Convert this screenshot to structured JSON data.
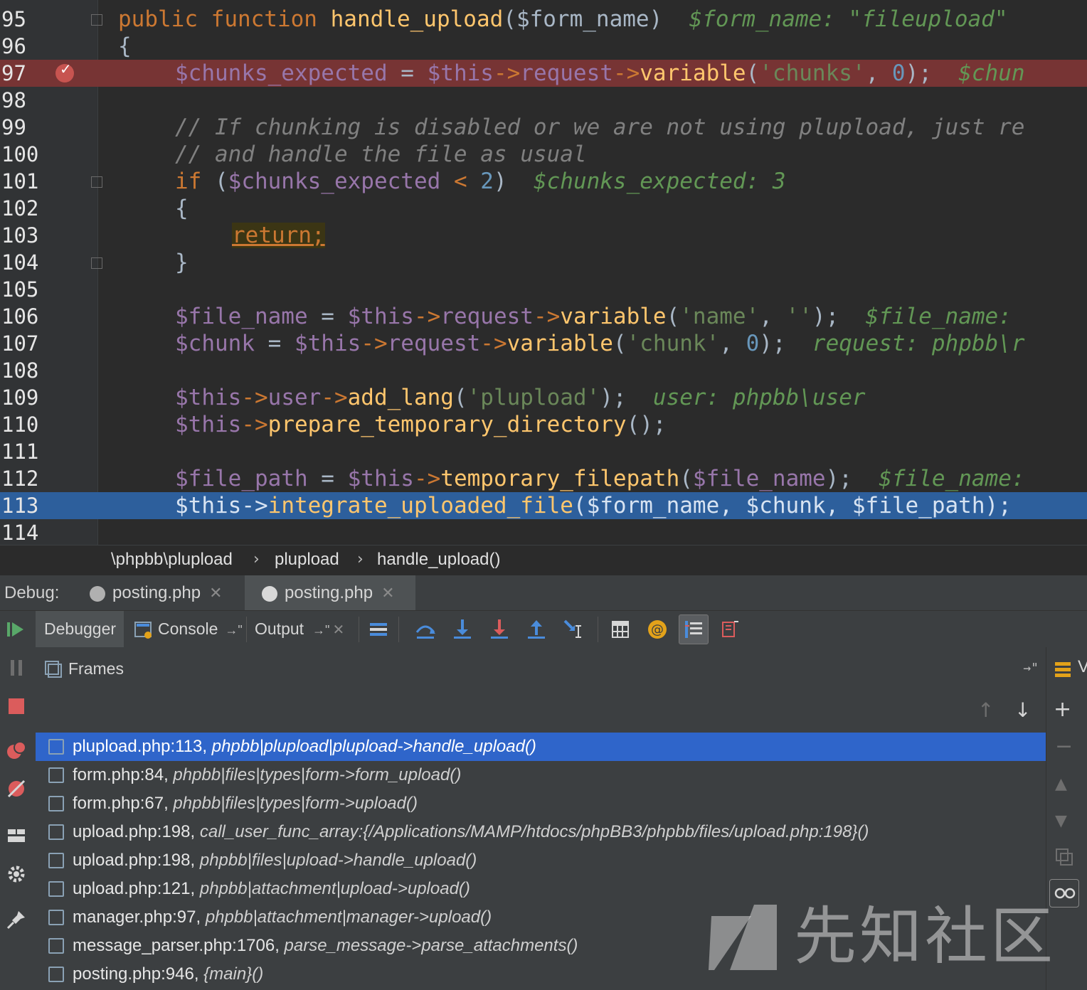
{
  "editor": {
    "lines": [
      {
        "num": "95"
      },
      {
        "num": "96"
      },
      {
        "num": "97"
      },
      {
        "num": "98"
      },
      {
        "num": "99"
      },
      {
        "num": "100"
      },
      {
        "num": "101"
      },
      {
        "num": "102"
      },
      {
        "num": "103"
      },
      {
        "num": "104"
      },
      {
        "num": "105"
      },
      {
        "num": "106"
      },
      {
        "num": "107"
      },
      {
        "num": "108"
      },
      {
        "num": "109"
      },
      {
        "num": "110"
      },
      {
        "num": "111"
      },
      {
        "num": "112"
      },
      {
        "num": "113"
      },
      {
        "num": "114"
      }
    ],
    "code": {
      "l95": {
        "kw1": "public",
        "kw2": "function",
        "fn": "handle_upload",
        "params": "($form_name)",
        "hint": "$form_name: \"fileupload\""
      },
      "l96": "{",
      "l97": {
        "var1": "$chunks_expected",
        "eq": " = ",
        "this": "$this",
        "arrow1": "->",
        "prop": "request",
        "arrow2": "->",
        "fn": "variable",
        "open": "(",
        "str": "'chunks'",
        "comma": ", ",
        "num": "0",
        "close": ");",
        "hint": "$chun"
      },
      "l99": "// If chunking is disabled or we are not using plupload, just re",
      "l100": "// and handle the file as usual",
      "l101": {
        "kw": "if",
        "open": " (",
        "var": "$chunks_expected",
        "op": " < ",
        "num": "2",
        "close": ")",
        "hint": "$chunks_expected: 3"
      },
      "l102": "{",
      "l103": {
        "kw": "return",
        "semi": ";"
      },
      "l104": "}",
      "l106": {
        "var": "$file_name",
        "eq": " = ",
        "this": "$this",
        "arrow1": "->",
        "prop": "request",
        "arrow2": "->",
        "fn": "variable",
        "open": "(",
        "str1": "'name'",
        "comma": ", ",
        "str2": "''",
        "close": ");",
        "hint": "$file_name:"
      },
      "l107": {
        "var": "$chunk",
        "eq": " = ",
        "this": "$this",
        "arrow1": "->",
        "prop": "request",
        "arrow2": "->",
        "fn": "variable",
        "open": "(",
        "str": "'chunk'",
        "comma": ", ",
        "num": "0",
        "close": ");",
        "hint": "request: phpbb\\r"
      },
      "l109": {
        "this": "$this",
        "arrow1": "->",
        "prop": "user",
        "arrow2": "->",
        "fn": "add_lang",
        "open": "(",
        "str": "'plupload'",
        "close": ");",
        "hint": "user: phpbb\\user"
      },
      "l110": {
        "this": "$this",
        "arrow1": "->",
        "fn": "prepare_temporary_directory",
        "close": "();"
      },
      "l112": {
        "var": "$file_path",
        "eq": " = ",
        "this": "$this",
        "arrow1": "->",
        "fn": "temporary_filepath",
        "open": "(",
        "arg": "$file_name",
        "close": ");",
        "hint": "$file_name:"
      },
      "l113": {
        "this": "$this",
        "arrow1": "->",
        "fn": "integrate_uploaded_file",
        "open": "(",
        "args": "$form_name, $chunk, $file_path",
        "close": ");"
      }
    }
  },
  "breadcrumb": [
    "\\phpbb\\plupload",
    "plupload",
    "handle_upload()"
  ],
  "debug": {
    "label": "Debug:",
    "tabs": [
      {
        "label": "posting.php"
      },
      {
        "label": "posting.php"
      }
    ]
  },
  "toolbar": {
    "debugger": "Debugger",
    "console": "Console",
    "output": "Output"
  },
  "frames": {
    "title": "Frames",
    "items": [
      {
        "loc": "plupload.php:113,",
        "fn": "phpbb|plupload|plupload->handle_upload()"
      },
      {
        "loc": "form.php:84,",
        "fn": "phpbb|files|types|form->form_upload()"
      },
      {
        "loc": "form.php:67,",
        "fn": "phpbb|files|types|form->upload()"
      },
      {
        "loc": "upload.php:198,",
        "fn": "call_user_func_array:{/Applications/MAMP/htdocs/phpBB3/phpbb/files/upload.php:198}()"
      },
      {
        "loc": "upload.php:198,",
        "fn": "phpbb|files|upload->handle_upload()"
      },
      {
        "loc": "upload.php:121,",
        "fn": "phpbb|attachment|upload->upload()"
      },
      {
        "loc": "manager.php:97,",
        "fn": "phpbb|attachment|manager->upload()"
      },
      {
        "loc": "message_parser.php:1706,",
        "fn": "parse_message->parse_attachments()"
      },
      {
        "loc": "posting.php:946,",
        "fn": "{main}()"
      }
    ]
  },
  "right_strip_label": "V",
  "watermark": {
    "text": "先知社区"
  },
  "colors": {
    "breakpoint_line": "#773434",
    "current_line": "#2d5f9c",
    "selected_frame": "#2f65ca"
  }
}
